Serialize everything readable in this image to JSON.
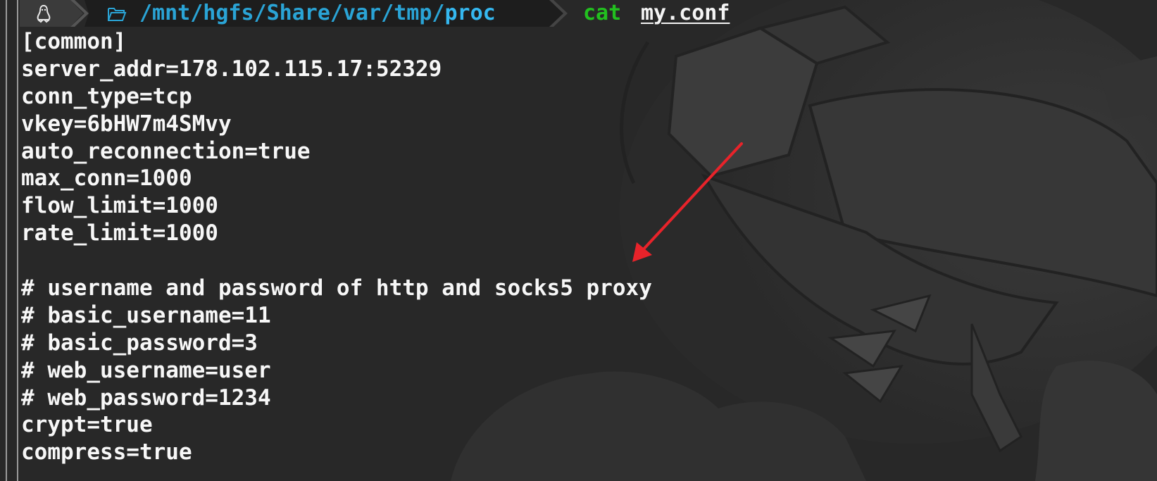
{
  "terminal": {
    "prompt": {
      "os_icon": "linux-penguin-icon",
      "folder_icon": "folder-open-icon",
      "path_dir": "/mnt/hgfs/Share/var/tmp/",
      "path_leaf": "proc",
      "command": "cat",
      "argument": "my.conf"
    },
    "output_lines": [
      "[common]",
      "server_addr=178.102.115.17:52329",
      "conn_type=tcp",
      "vkey=6bHW7m4SMvy",
      "auto_reconnection=true",
      "max_conn=1000",
      "flow_limit=1000",
      "rate_limit=1000",
      "",
      "# username and password of http and socks5 proxy",
      "# basic_username=11",
      "# basic_password=3",
      "# web_username=user",
      "# web_password=1234",
      "crypt=true",
      "compress=true"
    ]
  },
  "colors": {
    "background": "#2a2a2a",
    "prompt_segment_1": "#3b3b3b",
    "prompt_segment_2": "#1d1d1d",
    "path": "#2aa4d6",
    "command": "#22c01f",
    "output_text": "#f7f7f7",
    "annotation_arrow": "#e8232a"
  },
  "annotation": {
    "arrow_icon": "red-arrow-icon"
  }
}
